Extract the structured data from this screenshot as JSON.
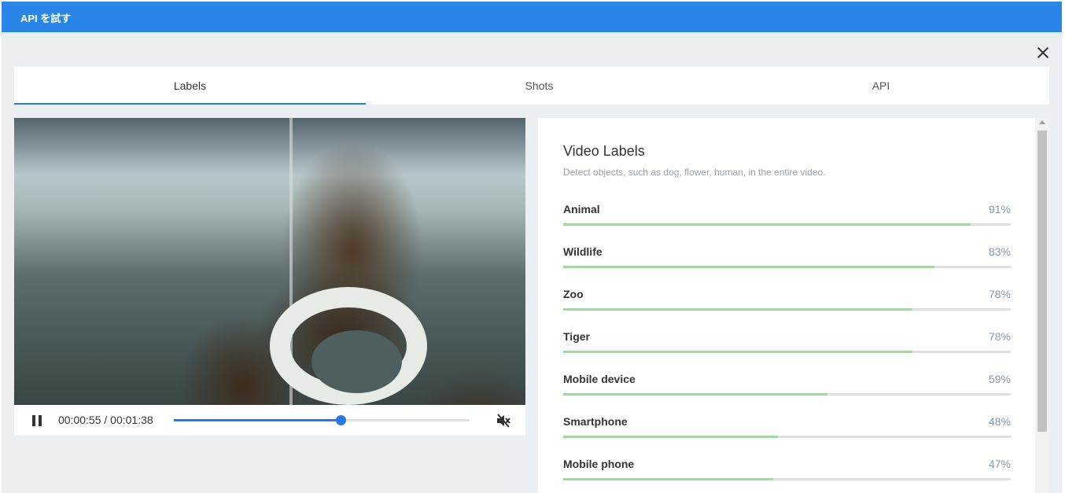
{
  "header": {
    "title": "API を試す"
  },
  "dialog": {
    "close_icon": "close-icon"
  },
  "tabs": [
    {
      "label": "Labels",
      "active": true
    },
    {
      "label": "Shots",
      "active": false
    },
    {
      "label": "API",
      "active": false
    }
  ],
  "player": {
    "time": "00:00:55 / 00:01:38",
    "progress": 0.563,
    "play_icon": "pause-icon",
    "mute_icon": "volume-mute-icon"
  },
  "video_labels": {
    "title": "Video Labels",
    "subtitle": "Detect objects, such as dog, flower, human, in the entire video.",
    "items": [
      {
        "name": "Animal",
        "pct": "91%",
        "value": 91
      },
      {
        "name": "Wildlife",
        "pct": "83%",
        "value": 83
      },
      {
        "name": "Zoo",
        "pct": "78%",
        "value": 78
      },
      {
        "name": "Tiger",
        "pct": "78%",
        "value": 78
      },
      {
        "name": "Mobile device",
        "pct": "59%",
        "value": 59
      },
      {
        "name": "Smartphone",
        "pct": "48%",
        "value": 48
      },
      {
        "name": "Mobile phone",
        "pct": "47%",
        "value": 47
      }
    ]
  },
  "colors": {
    "header": "#2a85e8",
    "accent": "#2a78e4",
    "bar": "#a7d5a7"
  }
}
